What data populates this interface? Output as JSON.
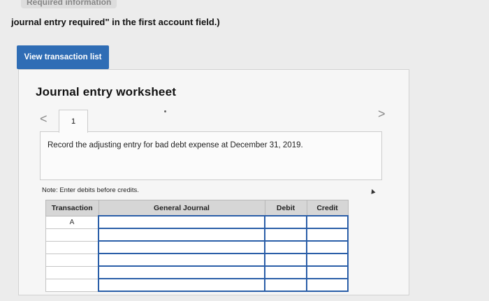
{
  "header": {
    "top_tab": "Required information",
    "instruction": "journal entry required\" in the first account field.)"
  },
  "toolbar": {
    "view_transactions_label": "View transaction list"
  },
  "worksheet": {
    "title": "Journal entry worksheet",
    "nav_prev": "<",
    "nav_next": ">",
    "tabs": [
      {
        "label": "1"
      }
    ],
    "description": "Record the adjusting entry for bad debt expense at December 31, 2019.",
    "note": "Note: Enter debits before credits."
  },
  "journal": {
    "columns": [
      "Transaction",
      "General Journal",
      "Debit",
      "Credit"
    ],
    "rows": [
      {
        "transaction": "A",
        "account": "",
        "debit": "",
        "credit": ""
      },
      {
        "transaction": "",
        "account": "",
        "debit": "",
        "credit": ""
      },
      {
        "transaction": "",
        "account": "",
        "debit": "",
        "credit": ""
      },
      {
        "transaction": "",
        "account": "",
        "debit": "",
        "credit": ""
      },
      {
        "transaction": "",
        "account": "",
        "debit": "",
        "credit": ""
      },
      {
        "transaction": "",
        "account": "",
        "debit": "",
        "credit": ""
      }
    ]
  },
  "colors": {
    "button_bg": "#2f6db5",
    "input_border": "#2a5ea8",
    "header_bg": "#d6d6d6"
  }
}
